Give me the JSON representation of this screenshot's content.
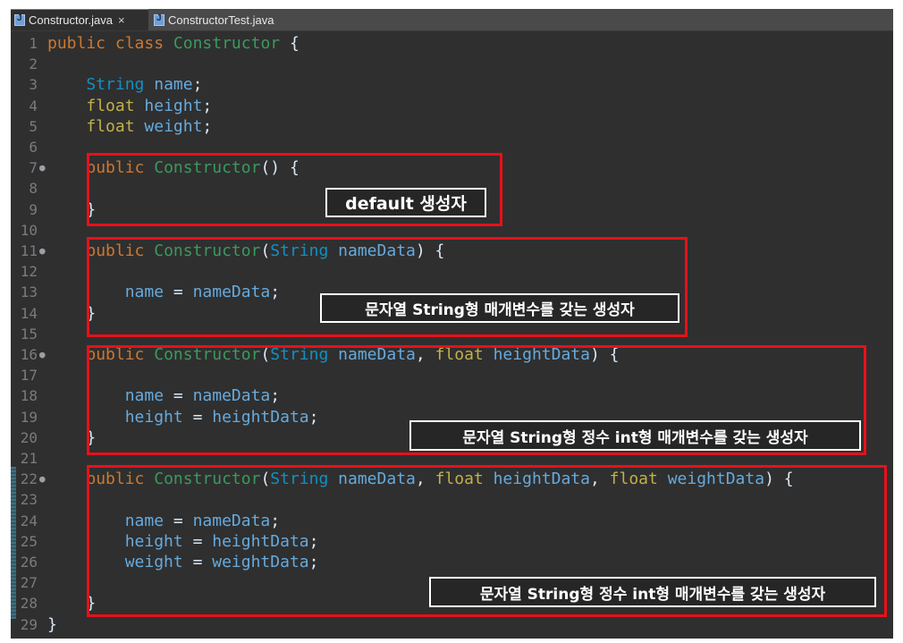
{
  "tabs": [
    {
      "label": "Constructor.java",
      "close": "×"
    },
    {
      "label": "ConstructorTest.java"
    }
  ],
  "code_lines": [
    {
      "n": "1",
      "t": "public class Constructor {"
    },
    {
      "n": "2",
      "t": ""
    },
    {
      "n": "3",
      "t": "    String name;"
    },
    {
      "n": "4",
      "t": "    float height;"
    },
    {
      "n": "5",
      "t": "    float weight;"
    },
    {
      "n": "6",
      "t": ""
    },
    {
      "n": "7",
      "t": "    public Constructor() {",
      "fold": true
    },
    {
      "n": "8",
      "t": ""
    },
    {
      "n": "9",
      "t": "    }"
    },
    {
      "n": "10",
      "t": ""
    },
    {
      "n": "11",
      "t": "    public Constructor(String nameData) {",
      "fold": true
    },
    {
      "n": "12",
      "t": ""
    },
    {
      "n": "13",
      "t": "        name = nameData;"
    },
    {
      "n": "14",
      "t": "    }"
    },
    {
      "n": "15",
      "t": ""
    },
    {
      "n": "16",
      "t": "    public Constructor(String nameData, float heightData) {",
      "fold": true
    },
    {
      "n": "17",
      "t": ""
    },
    {
      "n": "18",
      "t": "        name = nameData;"
    },
    {
      "n": "19",
      "t": "        height = heightData;"
    },
    {
      "n": "20",
      "t": "    }"
    },
    {
      "n": "21",
      "t": ""
    },
    {
      "n": "22",
      "t": "    public Constructor(String nameData, float heightData, float weightData) {",
      "fold": true
    },
    {
      "n": "23",
      "t": ""
    },
    {
      "n": "24",
      "t": "        name = nameData;"
    },
    {
      "n": "25",
      "t": "        height = heightData;"
    },
    {
      "n": "26",
      "t": "        weight = weightData;"
    },
    {
      "n": "27",
      "t": ""
    },
    {
      "n": "28",
      "t": "    }"
    },
    {
      "n": "29",
      "t": "}"
    }
  ],
  "annotations": [
    "default 생성자",
    "문자열 String형 매개변수를 갖는 생성자",
    "문자열 String형 정수 int형 매개변수를 갖는 생성자",
    "문자열 String형 정수 int형 매개변수를 갖는 생성자"
  ],
  "colors": {
    "editor_bg": "#2f2f2f",
    "highlight_box": "#e8101a",
    "keyword": "#cc7832",
    "type": "#1290c3",
    "class_name": "#3a9a5e"
  }
}
